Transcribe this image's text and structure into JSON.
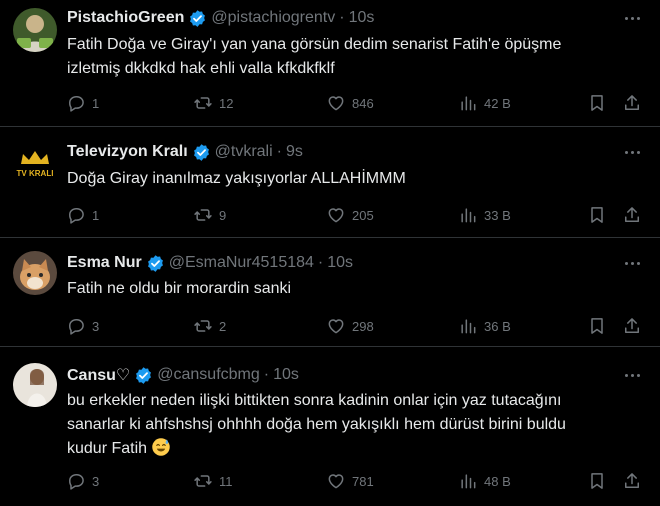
{
  "colors": {
    "background": "#000000",
    "text": "#e7e9ea",
    "muted": "#71767b",
    "verified": "#1d9bf0",
    "divider": "#2f3336"
  },
  "tweets": [
    {
      "name": "PistachioGreen",
      "handle": "@pistachiogrentv",
      "time": "10s",
      "lines": [
        "Fatih Doğa ve Giray'ı yan yana görsün dedim senarist Fatih'e öpüşme",
        "izletmiş dkkdkd hak ehli valla kfkdkfklf"
      ],
      "replies": "1",
      "retweets": "12",
      "likes": "846",
      "views": "42 B"
    },
    {
      "name": "Televizyon Kralı",
      "handle": "@tvkrali",
      "time": "9s",
      "avatar_text": "TV KRALI",
      "lines": [
        "Doğa Giray inanılmaz yakışıyorlar ALLAHİMMM"
      ],
      "replies": "1",
      "retweets": "9",
      "likes": "205",
      "views": "33 B"
    },
    {
      "name": "Esma Nur",
      "handle": "@EsmaNur4515184",
      "time": "10s",
      "lines": [
        "Fatih ne oldu bir morardin sanki"
      ],
      "replies": "3",
      "retweets": "2",
      "likes": "298",
      "views": "36 B"
    },
    {
      "name": "Cansu♡",
      "handle": "@cansufcbmg",
      "time": "10s",
      "lines": [
        "bu erkekler neden ilişki bittikten sonra kadinin onlar için yaz tutacağını",
        "sanarlar ki ahfshshsj ohhhh doğa hem yakışıklı hem dürüst birini buldu",
        "kudur Fatih"
      ],
      "emoji": "sweat-smile-emoji",
      "replies": "3",
      "retweets": "11",
      "likes": "781",
      "views": "48 B"
    }
  ]
}
